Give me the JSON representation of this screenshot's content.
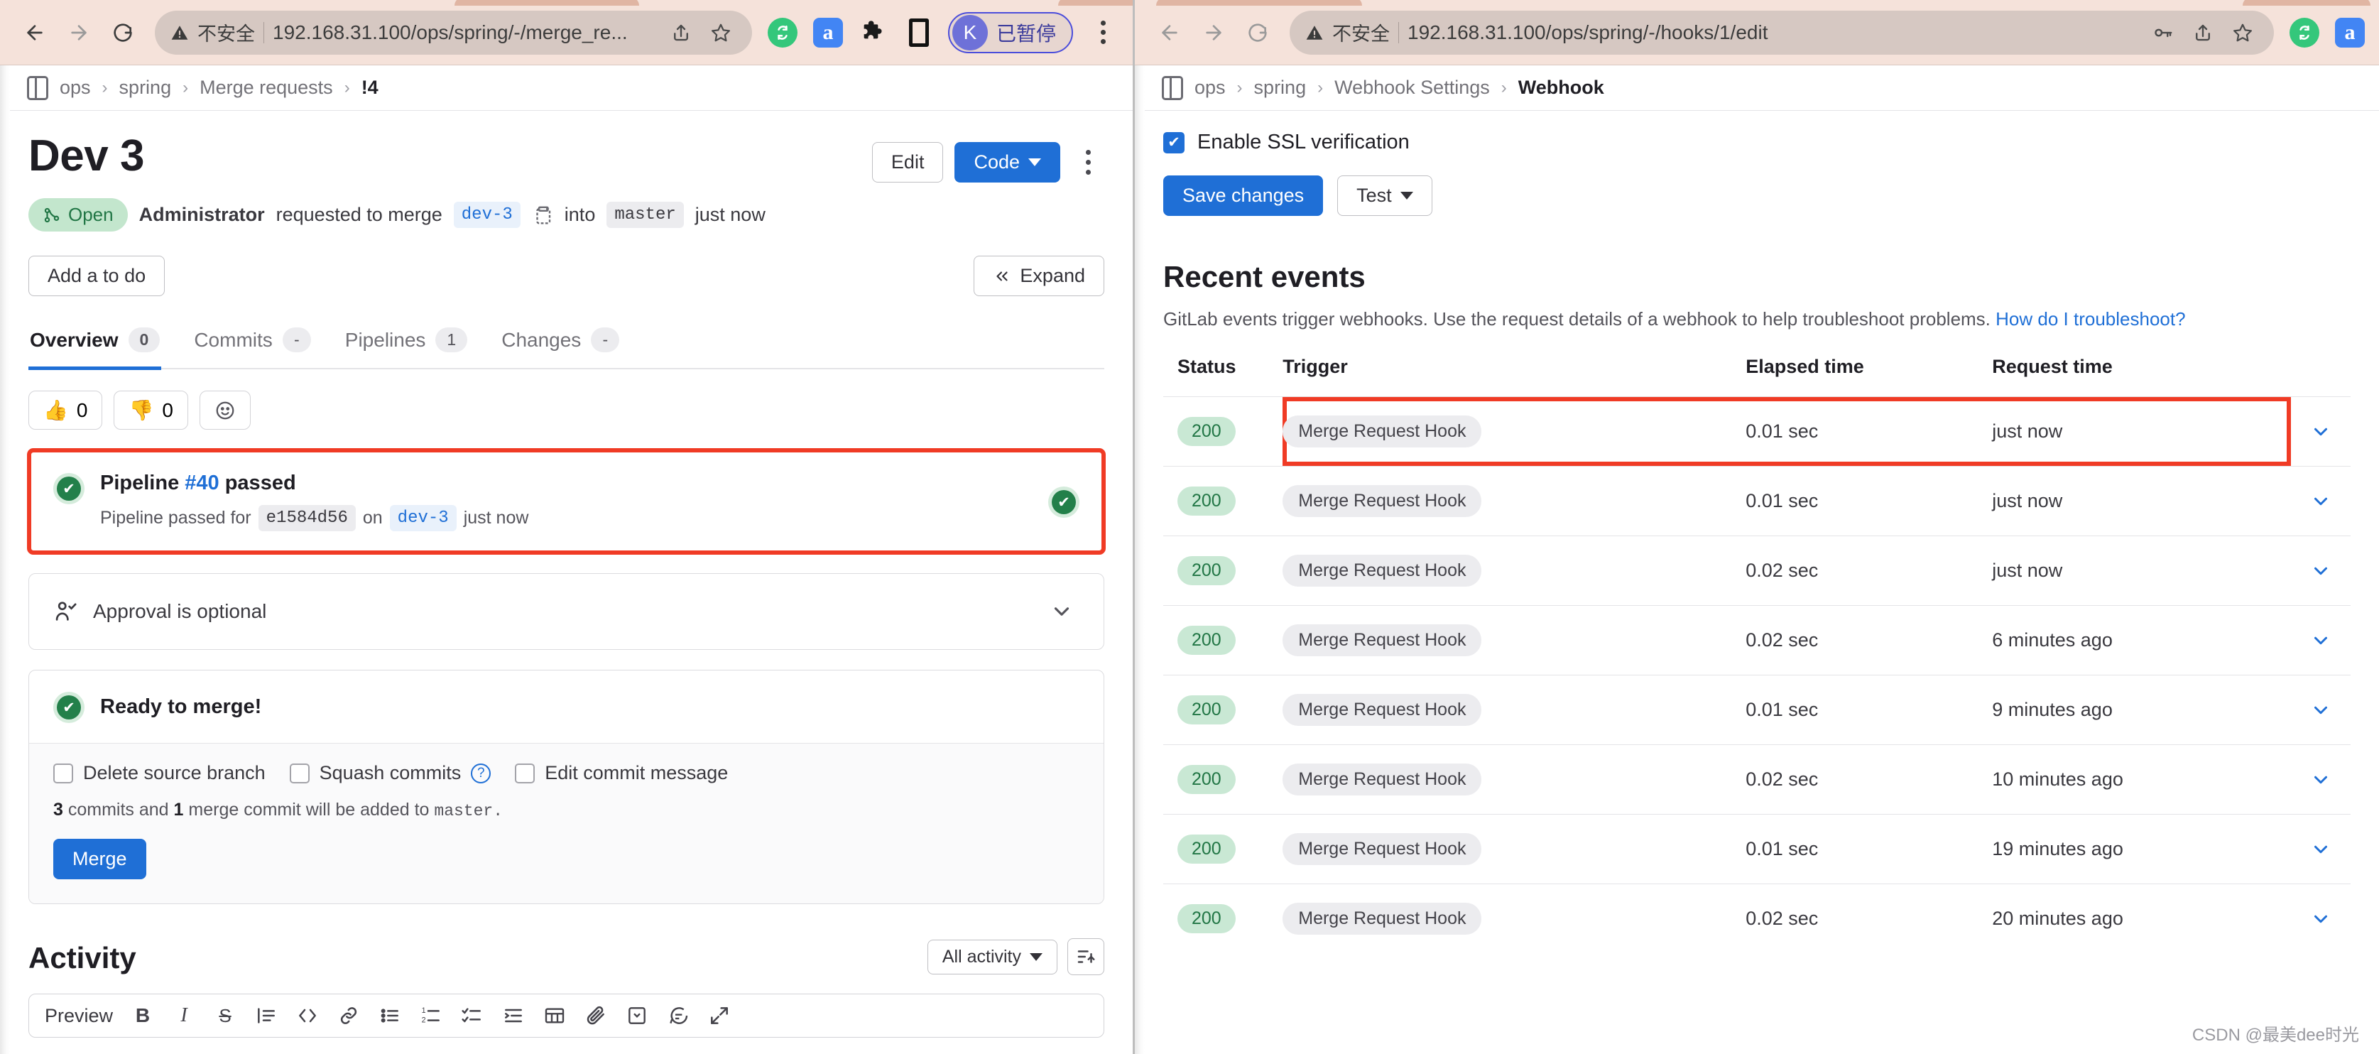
{
  "left_window": {
    "browser": {
      "back_icon": "back-arrow-icon",
      "forward_icon": "forward-arrow-icon",
      "reload_icon": "reload-icon",
      "security_label": "不安全",
      "url": "192.168.31.100/ops/spring/-/merge_re...",
      "share_icon": "share-icon",
      "bookmark_icon": "star-icon",
      "extensions": [
        "sync-icon",
        "a-extension-icon",
        "puzzle-icon",
        "sidebar-icon"
      ],
      "profile_initial": "K",
      "profile_status": "已暂停",
      "menu_icon": "kebab-menu-icon"
    },
    "breadcrumb": {
      "panel_icon": "panel-toggle-icon",
      "items": [
        "ops",
        "spring",
        "Merge requests",
        "!4"
      ]
    },
    "header": {
      "title": "Dev 3",
      "edit_button": "Edit",
      "code_button": "Code",
      "more_icon": "vertical-dots-icon"
    },
    "meta": {
      "status_badge": "Open",
      "status_icon": "merge-request-icon",
      "author": "Administrator",
      "action_text": "requested to merge",
      "source_branch": "dev-3",
      "copy_icon": "copy-icon",
      "into_text": "into",
      "target_branch": "master",
      "time_text": "just now"
    },
    "toolbar": {
      "add_todo": "Add a to do",
      "expand": "Expand",
      "expand_icon": "chevrons-left-icon"
    },
    "tabs": [
      {
        "label": "Overview",
        "count": "0",
        "active": true
      },
      {
        "label": "Commits",
        "count": "-",
        "active": false
      },
      {
        "label": "Pipelines",
        "count": "1",
        "active": false
      },
      {
        "label": "Changes",
        "count": "-",
        "active": false
      }
    ],
    "reactions": [
      {
        "emoji": "👍",
        "count": "0",
        "name": "thumbsup-reaction-button"
      },
      {
        "emoji": "👎",
        "count": "0",
        "name": "thumbsdown-reaction-button"
      }
    ],
    "add_reaction_icon": "smiley-icon",
    "pipeline": {
      "status_icon": "check-circle-icon",
      "title_prefix": "Pipeline",
      "pipeline_id": "#40",
      "title_suffix": "passed",
      "sub_prefix": "Pipeline passed for",
      "commit_sha": "e1584d56",
      "sub_on": "on",
      "branch": "dev-3",
      "sub_time": "just now",
      "right_status_icon": "check-circle-icon"
    },
    "approval": {
      "icon": "approval-user-icon",
      "text": "Approval is optional",
      "expand_icon": "chevron-down-icon"
    },
    "merge": {
      "status_icon": "check-circle-icon",
      "heading": "Ready to merge!",
      "options": [
        {
          "label": "Delete source branch",
          "checked": false
        },
        {
          "label": "Squash commits",
          "checked": false,
          "help_icon": "question-circle-icon"
        },
        {
          "label": "Edit commit message",
          "checked": false
        }
      ],
      "note_commits": "3",
      "note_mid": "commits and",
      "note_merge_commits": "1",
      "note_tail": "merge commit will be added to",
      "note_branch": "master.",
      "merge_button": "Merge"
    },
    "activity": {
      "title": "Activity",
      "filter_label": "All activity",
      "filter_caret_icon": "chevron-down-icon",
      "sort_icon": "sort-descending-icon",
      "editor_preview": "Preview",
      "editor_icons": [
        "bold-icon",
        "italic-icon",
        "strikethrough-icon",
        "quote-icon",
        "code-icon",
        "link-icon",
        "bulleted-list-icon",
        "numbered-list-icon",
        "checklist-icon",
        "indent-icon",
        "table-icon",
        "attachment-icon",
        "collapsible-icon",
        "comment-template-icon",
        "fullscreen-icon"
      ]
    }
  },
  "right_window": {
    "browser": {
      "back_icon": "back-arrow-icon",
      "forward_icon": "forward-arrow-icon",
      "reload_icon": "reload-icon",
      "security_label": "不安全",
      "url": "192.168.31.100/ops/spring/-/hooks/1/edit",
      "key_icon": "password-key-icon",
      "share_icon": "share-icon",
      "bookmark_icon": "star-icon",
      "extensions": [
        "sync-icon",
        "a-extension-icon"
      ]
    },
    "breadcrumb": {
      "panel_icon": "panel-toggle-icon",
      "items": [
        "ops",
        "spring",
        "Webhook Settings",
        "Webhook"
      ]
    },
    "settings": {
      "ssl_label": "Enable SSL verification",
      "ssl_checked": true,
      "save_button": "Save changes",
      "test_button": "Test",
      "test_caret_icon": "chevron-down-icon"
    },
    "recent_events": {
      "title": "Recent events",
      "description": "GitLab events trigger webhooks. Use the request details of a webhook to help troubleshoot problems.",
      "help_link": "How do I troubleshoot?",
      "columns": [
        "Status",
        "Trigger",
        "Elapsed time",
        "Request time"
      ],
      "rows": [
        {
          "status": "200",
          "trigger": "Merge Request Hook",
          "elapsed": "0.01 sec",
          "request_time": "just now",
          "highlighted": true
        },
        {
          "status": "200",
          "trigger": "Merge Request Hook",
          "elapsed": "0.01 sec",
          "request_time": "just now",
          "highlighted": false
        },
        {
          "status": "200",
          "trigger": "Merge Request Hook",
          "elapsed": "0.02 sec",
          "request_time": "just now",
          "highlighted": false
        },
        {
          "status": "200",
          "trigger": "Merge Request Hook",
          "elapsed": "0.02 sec",
          "request_time": "6 minutes ago",
          "highlighted": false
        },
        {
          "status": "200",
          "trigger": "Merge Request Hook",
          "elapsed": "0.01 sec",
          "request_time": "9 minutes ago",
          "highlighted": false
        },
        {
          "status": "200",
          "trigger": "Merge Request Hook",
          "elapsed": "0.02 sec",
          "request_time": "10 minutes ago",
          "highlighted": false
        },
        {
          "status": "200",
          "trigger": "Merge Request Hook",
          "elapsed": "0.01 sec",
          "request_time": "19 minutes ago",
          "highlighted": false
        },
        {
          "status": "200",
          "trigger": "Merge Request Hook",
          "elapsed": "0.02 sec",
          "request_time": "20 minutes ago",
          "highlighted": false
        }
      ],
      "row_chevron_icon": "chevron-down-icon"
    }
  },
  "watermark": "CSDN @最美dee时光"
}
